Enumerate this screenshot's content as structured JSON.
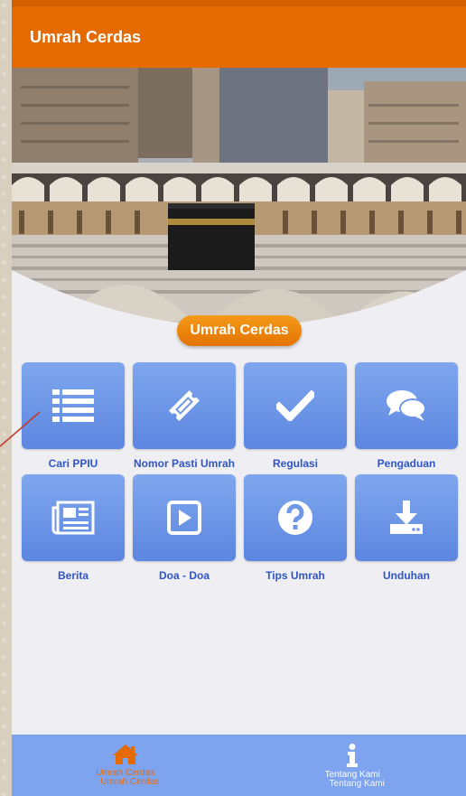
{
  "app": {
    "title": "Umrah Cerdas"
  },
  "hero": {
    "pill_label": "Umrah Cerdas"
  },
  "menu": [
    {
      "label": "Cari PPIU",
      "icon": "list-icon"
    },
    {
      "label": "Nomor Pasti Umrah",
      "icon": "ticket-icon"
    },
    {
      "label": "Regulasi",
      "icon": "check-icon"
    },
    {
      "label": "Pengaduan",
      "icon": "chat-icon"
    },
    {
      "label": "Berita",
      "icon": "newspaper-icon"
    },
    {
      "label": "Doa - Doa",
      "icon": "play-icon"
    },
    {
      "label": "Tips Umrah",
      "icon": "question-icon"
    },
    {
      "label": "Unduhan",
      "icon": "download-icon"
    }
  ],
  "bottom_nav": [
    {
      "label": "Umrah Cerdas",
      "label_echo": "Umrah Cerdas",
      "icon": "home-icon",
      "active": true
    },
    {
      "label": "Tentang Kami",
      "label_echo": "Tentang Kami",
      "icon": "info-icon",
      "active": false
    }
  ],
  "colors": {
    "primary": "#e56a00",
    "tile": "#6f97e8",
    "tile_label": "#2f55c9",
    "nav_bg": "#7ea4f0"
  }
}
